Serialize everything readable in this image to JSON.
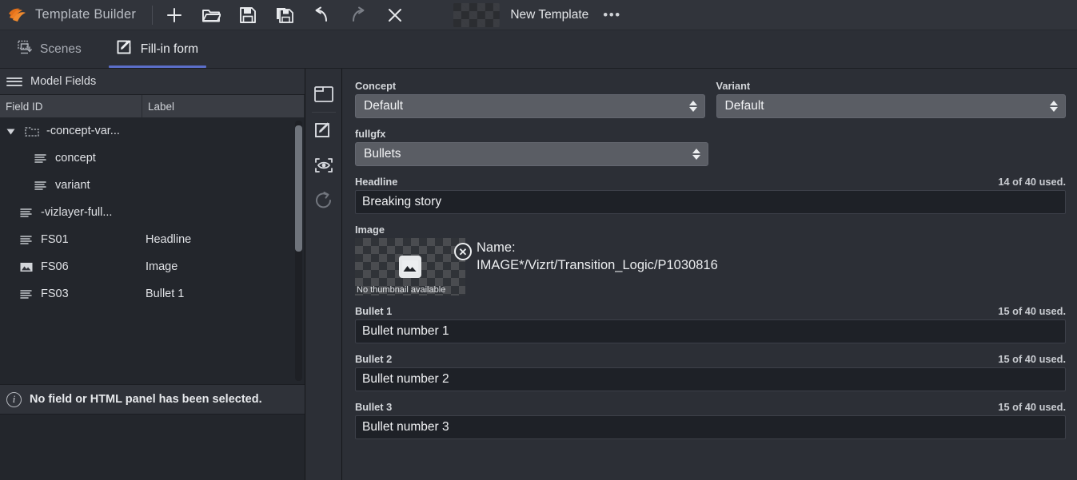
{
  "titlebar": {
    "app_name": "Template Builder",
    "logo_icon": "vizrt-flame-logo-icon",
    "document_title": "New Template",
    "overflow_label": "•••",
    "buttons": [
      {
        "name": "new",
        "icon": "plus-icon",
        "label": "New"
      },
      {
        "name": "open",
        "icon": "folder-open-icon",
        "label": "Open"
      },
      {
        "name": "save",
        "icon": "save-icon",
        "label": "Save"
      },
      {
        "name": "save-as",
        "icon": "save-as-icon",
        "label": "Save As"
      },
      {
        "name": "undo",
        "icon": "undo-icon",
        "label": "Undo"
      },
      {
        "name": "redo",
        "icon": "redo-icon",
        "label": "Redo"
      },
      {
        "name": "close",
        "icon": "close-icon",
        "label": "Close"
      }
    ]
  },
  "tabs": [
    {
      "label": "Scenes",
      "icon": "scenes-icon",
      "active": false
    },
    {
      "label": "Fill-in form",
      "icon": "fill-in-form-icon",
      "active": true
    }
  ],
  "left_panel": {
    "header_title": "Model Fields",
    "header_icon": "hamburger-icon",
    "columns": [
      "Field ID",
      "Label"
    ],
    "rows": [
      {
        "id": "-concept-var...",
        "label": "",
        "icon": "folder-dashed-icon",
        "expanded": true,
        "level": 0
      },
      {
        "id": "concept",
        "label": "",
        "icon": "text-field-icon",
        "level": 1
      },
      {
        "id": "variant",
        "label": "",
        "icon": "text-field-icon",
        "level": 1
      },
      {
        "id": "-vizlayer-full...",
        "label": "",
        "icon": "text-field-icon",
        "level": 0
      },
      {
        "id": "FS01",
        "label": "Headline",
        "icon": "text-field-icon",
        "level": 0
      },
      {
        "id": "FS06",
        "label": "Image",
        "icon": "image-field-icon",
        "level": 0
      },
      {
        "id": "FS03",
        "label": "Bullet 1",
        "icon": "text-field-icon",
        "level": 0
      }
    ],
    "info_message": "No field or HTML panel has been selected.",
    "info_icon": "info-icon"
  },
  "rail": [
    {
      "name": "scene-window",
      "icon": "window-folder-icon",
      "enabled": true
    },
    {
      "name": "edit-fields",
      "icon": "edit-pencil-icon",
      "enabled": true
    },
    {
      "name": "preview",
      "icon": "preview-eye-icon",
      "enabled": true
    },
    {
      "name": "refresh",
      "icon": "refresh-icon",
      "enabled": false
    }
  ],
  "form": {
    "concept": {
      "label": "Concept",
      "value": "Default"
    },
    "variant": {
      "label": "Variant",
      "value": "Default"
    },
    "fullgfx": {
      "label": "fullgfx",
      "value": "Bullets"
    },
    "headline": {
      "label": "Headline",
      "value": "Breaking story",
      "counter": "14 of 40 used."
    },
    "image": {
      "label": "Image",
      "thumb_caption": "No thumbnail available",
      "name_label": "Name:",
      "name_value": "IMAGE*/Vizrt/Transition_Logic/P1030816",
      "remove_label": "✕"
    },
    "bullets": [
      {
        "label": "Bullet 1",
        "value": "Bullet number 1",
        "counter": "15 of 40 used."
      },
      {
        "label": "Bullet 2",
        "value": "Bullet number 2",
        "counter": "15 of 40 used."
      },
      {
        "label": "Bullet 3",
        "value": "Bullet number 3",
        "counter": "15 of 40 used."
      }
    ]
  },
  "colors": {
    "accent": "#5b6ec9",
    "logo": "#ef7d22",
    "titlebar_bg": "#31343b",
    "panel_bg": "#23262c",
    "form_bg": "#2c2f36",
    "input_bg": "#1e2127",
    "select_bg": "#5a5d64"
  }
}
